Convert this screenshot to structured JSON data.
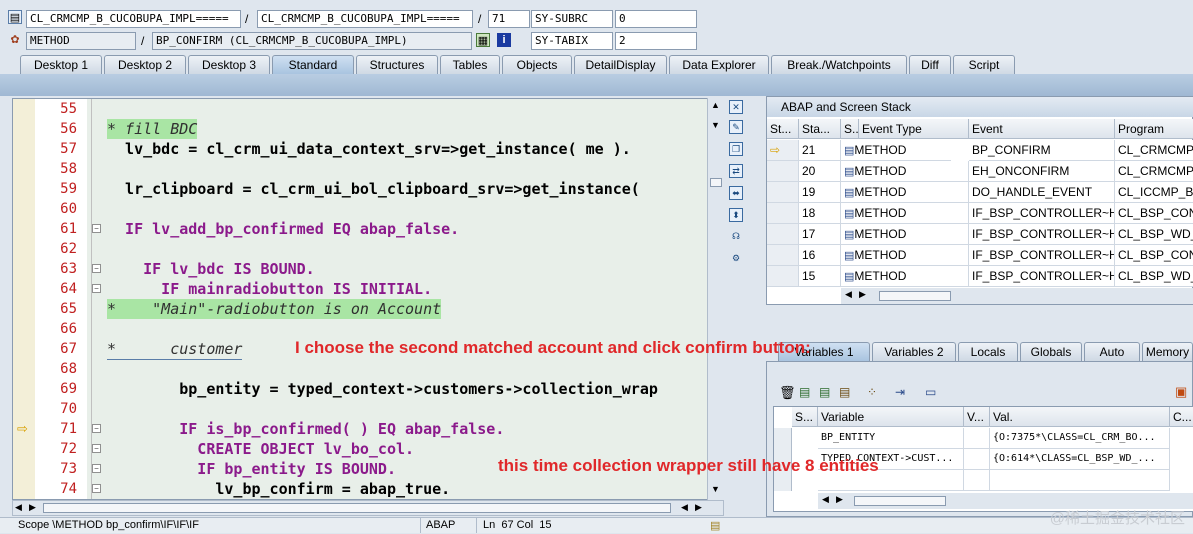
{
  "header": {
    "row1": {
      "field1": "CL_CRMCMP_B_CUCOBUPA_IMPL=====",
      "sep1": "/",
      "field2": "CL_CRMCMP_B_CUCOBUPA_IMPL=====",
      "sep2": "/",
      "field3": "71",
      "sysvar": "SY-SUBRC",
      "sysval": "0"
    },
    "row2": {
      "field1": "METHOD",
      "sep1": "/",
      "field2": "BP_CONFIRM (CL_CRMCMP_B_CUCOBUPA_IMPL)",
      "sysvar": "SY-TABIX",
      "sysval": "2"
    }
  },
  "tabs": [
    "Desktop 1",
    "Desktop 2",
    "Desktop 3",
    "Standard",
    "Structures",
    "Tables",
    "Objects",
    "DetailDisplay",
    "Data Explorer",
    "Break./Watchpoints",
    "Diff",
    "Script"
  ],
  "active_tab": "Standard",
  "editor": {
    "lines": [
      {
        "num": "55",
        "code": ""
      },
      {
        "num": "56",
        "code": "* fill BDC"
      },
      {
        "num": "57",
        "code": "  lv_bdc = cl_crm_ui_data_context_srv=>get_instance( me )."
      },
      {
        "num": "58",
        "code": ""
      },
      {
        "num": "59",
        "code": "  lr_clipboard = cl_crm_ui_bol_clipboard_srv=>get_instance("
      },
      {
        "num": "60",
        "code": ""
      },
      {
        "num": "61",
        "code": "  IF lv_add_bp_confirmed EQ abap_false."
      },
      {
        "num": "62",
        "code": ""
      },
      {
        "num": "63",
        "code": "    IF lv_bdc IS BOUND."
      },
      {
        "num": "64",
        "code": "      IF mainradiobutton IS INITIAL."
      },
      {
        "num": "65",
        "code": "*    \"Main\"-radiobutton is on Account"
      },
      {
        "num": "66",
        "code": ""
      },
      {
        "num": "67",
        "code": "*      customer"
      },
      {
        "num": "68",
        "code": ""
      },
      {
        "num": "69",
        "code": "        bp_entity = typed_context->customers->collection_wrap"
      },
      {
        "num": "70",
        "code": ""
      },
      {
        "num": "71",
        "code": "        IF is_bp_confirmed( ) EQ abap_false."
      },
      {
        "num": "72",
        "code": "          CREATE OBJECT lv_bo_col."
      },
      {
        "num": "73",
        "code": "          IF bp_entity IS BOUND."
      },
      {
        "num": "74",
        "code": "            lv_bp_confirm = abap_true."
      }
    ]
  },
  "annotations": {
    "a1": "I choose the second matched account and click confirm button:",
    "a2": "this time collection wrapper still have 8 entities"
  },
  "stack": {
    "title": "ABAP and Screen Stack",
    "columns": [
      "St...",
      "Sta...",
      "S...",
      "Event Type",
      "Event",
      "Program"
    ],
    "rows": [
      {
        "level": "21",
        "type": "METHOD",
        "event": "BP_CONFIRM",
        "program": "CL_CRMCMP_B"
      },
      {
        "level": "20",
        "type": "METHOD",
        "event": "EH_ONCONFIRM",
        "program": "CL_CRMCMP_B"
      },
      {
        "level": "19",
        "type": "METHOD",
        "event": "DO_HANDLE_EVENT",
        "program": "CL_ICCMP_BP_"
      },
      {
        "level": "18",
        "type": "METHOD",
        "event": "IF_BSP_CONTROLLER~H...",
        "program": "CL_BSP_CONT"
      },
      {
        "level": "17",
        "type": "METHOD",
        "event": "IF_BSP_CONTROLLER~H...",
        "program": "CL_BSP_WD_V"
      },
      {
        "level": "16",
        "type": "METHOD",
        "event": "IF_BSP_CONTROLLER~H...",
        "program": "CL_BSP_CONT"
      },
      {
        "level": "15",
        "type": "METHOD",
        "event": "IF_BSP_CONTROLLER~H...",
        "program": "CL_BSP_WD_V"
      }
    ]
  },
  "var_tabs": [
    "Variables 1",
    "Variables 2",
    "Locals",
    "Globals",
    "Auto",
    "Memory"
  ],
  "vars": {
    "columns": [
      "S...",
      "Variable",
      "V...",
      "Val.",
      "C..."
    ],
    "rows": [
      {
        "name": "BP_ENTITY",
        "val": "{O:7375*\\CLASS=CL_CRM_BO..."
      },
      {
        "name": "TYPED_CONTEXT->CUST...",
        "val": "{O:614*\\CLASS=CL_BSP_WD_..."
      }
    ]
  },
  "status": {
    "scope": "Scope \\METHOD bp_confirm\\IF\\IF\\IF",
    "lang": "ABAP",
    "pos": "Ln  67 Col  15"
  },
  "watermark": "@稀土掘金技术社区"
}
